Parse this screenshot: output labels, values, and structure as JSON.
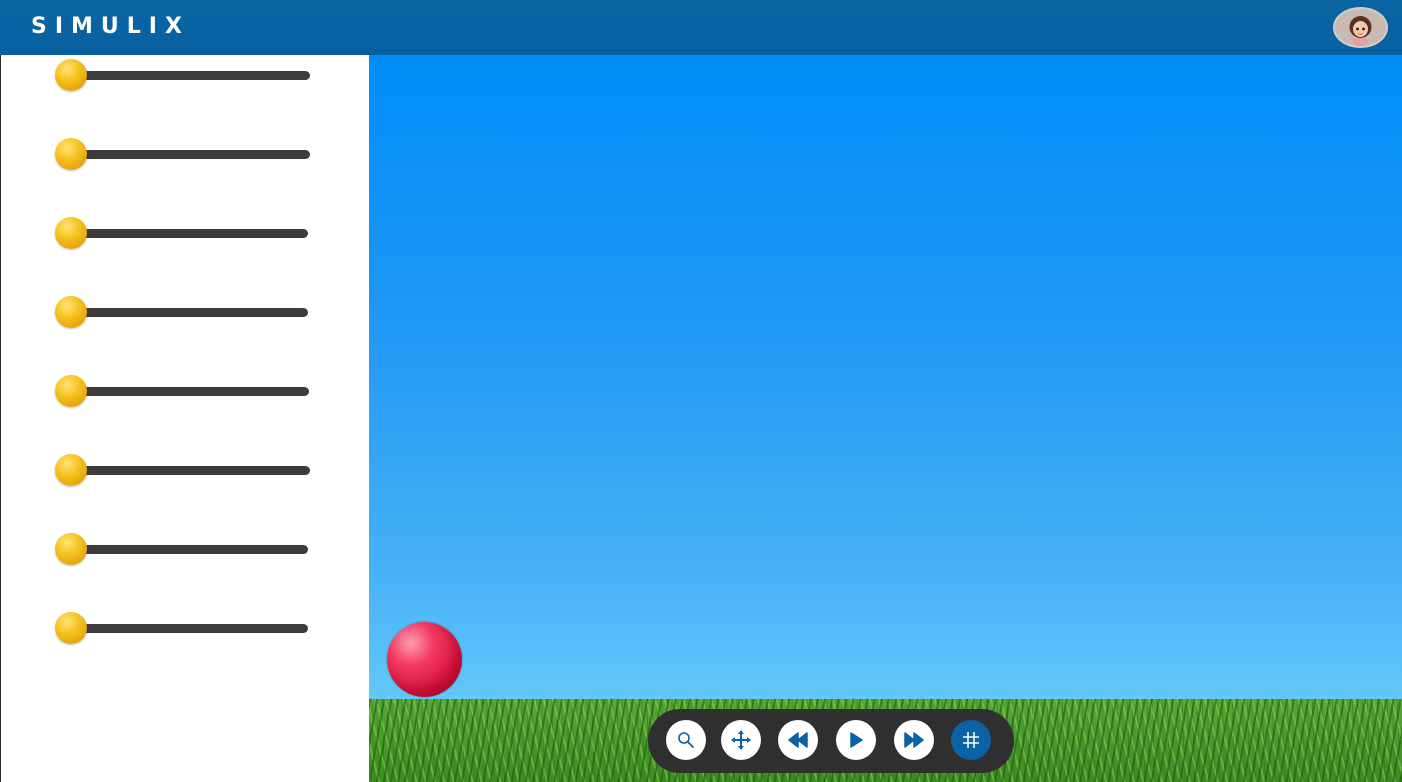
{
  "header": {
    "logo_text": "SIMULIX",
    "avatar_icon": "user-avatar-icon",
    "color": "#0a65a3"
  },
  "sidebar": {
    "sliders": [
      {
        "value": 0
      },
      {
        "value": 0
      },
      {
        "value": 0
      },
      {
        "value": 0
      },
      {
        "value": 0
      },
      {
        "value": 0
      },
      {
        "value": 0
      },
      {
        "value": 0
      }
    ],
    "thumb_color": "#f6c21e",
    "track_color": "#3c3c3c"
  },
  "scene": {
    "sky_color": "#1e97f6",
    "grass_color": "#4a9a30",
    "ball_color": "#e8204a"
  },
  "toolbar": {
    "buttons": [
      {
        "icon": "zoom-icon"
      },
      {
        "icon": "move-icon"
      },
      {
        "icon": "rewind-icon"
      },
      {
        "icon": "play-icon"
      },
      {
        "icon": "fast-forward-icon"
      },
      {
        "icon": "grid-icon",
        "active": true
      }
    ],
    "accent": "#0b63a5"
  }
}
